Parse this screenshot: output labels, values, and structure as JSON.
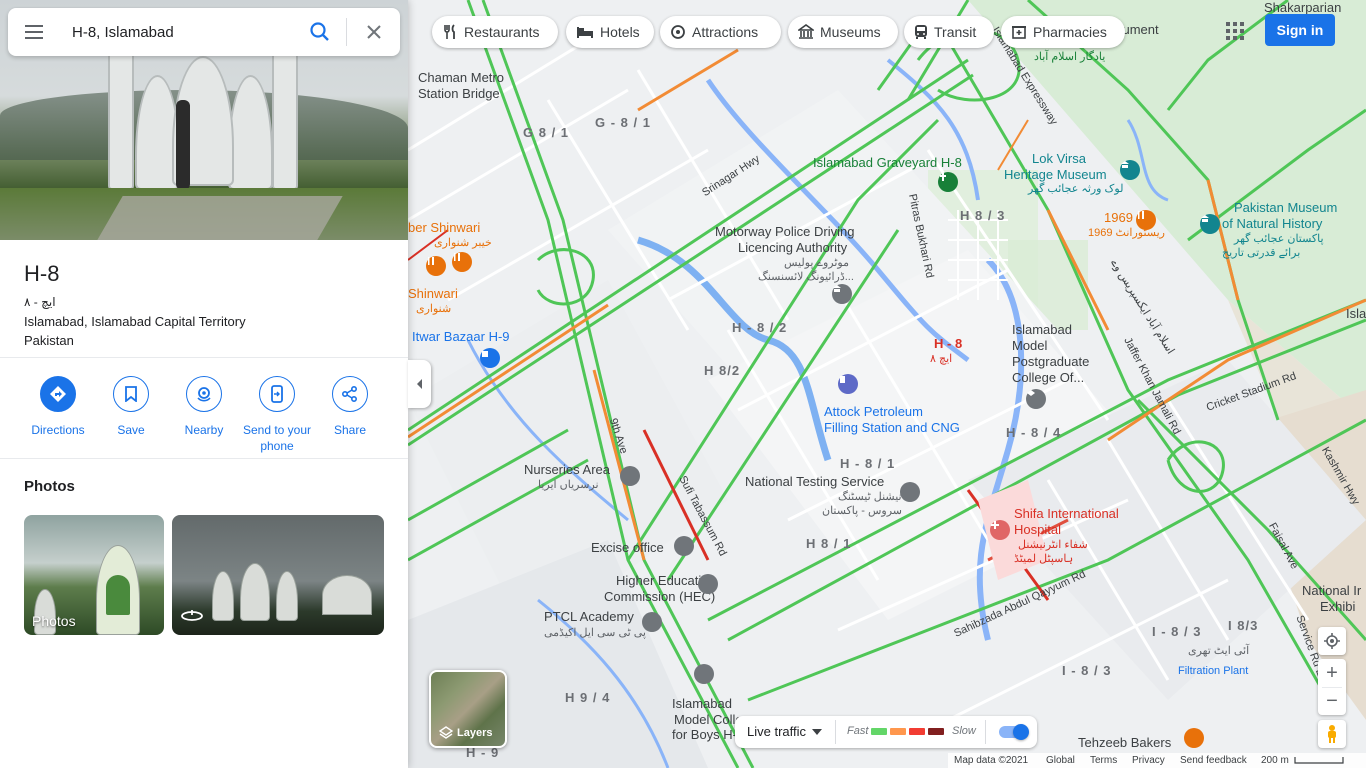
{
  "search": {
    "value": "H-8, Islamabad",
    "menu_icon": "hamburger-menu-icon",
    "search_icon": "magnifier-icon",
    "clear_icon": "close-icon"
  },
  "place": {
    "title": "H-8",
    "subtitle": "ایچ - ۸",
    "address_line1": "Islamabad, Islamabad Capital Territory",
    "address_line2": "Pakistan"
  },
  "actions": [
    {
      "label": "Directions",
      "icon": "directions-icon"
    },
    {
      "label": "Save",
      "icon": "bookmark-icon"
    },
    {
      "label": "Nearby",
      "icon": "nearby-icon"
    },
    {
      "label": "Send to your phone",
      "icon": "phone-send-icon"
    },
    {
      "label": "Share",
      "icon": "share-icon"
    }
  ],
  "photos": {
    "title": "Photos",
    "items": [
      {
        "label": "Photos"
      },
      {
        "label": "",
        "icon": "360-icon"
      }
    ]
  },
  "chips": [
    {
      "label": "Restaurants",
      "icon": "fork-knife-icon"
    },
    {
      "label": "Hotels",
      "icon": "bed-icon"
    },
    {
      "label": "Attractions",
      "icon": "attraction-icon"
    },
    {
      "label": "Museums",
      "icon": "museum-icon"
    },
    {
      "label": "Transit",
      "icon": "bus-icon"
    },
    {
      "label": "Pharmacies",
      "icon": "pharmacy-icon"
    }
  ],
  "top_right": {
    "apps_icon": "apps-grid-icon",
    "sign_in": "Sign in"
  },
  "layers": {
    "label": "Layers",
    "icon": "layers-icon"
  },
  "traffic": {
    "select_label": "Live traffic",
    "fast": "Fast",
    "slow": "Slow",
    "colors": [
      "#63d668",
      "#ff974d",
      "#f23c32",
      "#811f1f"
    ],
    "toggle_on": true
  },
  "map_controls": {
    "locate_icon": "my-location-icon",
    "zoom_in": "+",
    "zoom_out": "−",
    "pegman_icon": "pegman-icon"
  },
  "footer": {
    "map_data": "Map data ©2021",
    "global": "Global",
    "terms": "Terms",
    "privacy": "Privacy",
    "feedback": "Send feedback",
    "scale": "200 m"
  },
  "map_labels": {
    "chaman_metro": "Chaman Metro",
    "station_bridge": "Station Bridge",
    "g81a": "G 8 / 1",
    "g81b": "G - 8 / 1",
    "onument": "onument",
    "pakistan_monument_urdu": "یادگار اسلام آباد",
    "srinagar_hwy": "Srinagar Hwy",
    "graveyard": "Islamabad Graveyard H-8",
    "lok_virsa_1": "Lok Virsa",
    "lok_virsa_2": "Heritage Museum",
    "lok_virsa_urdu": "لوک ورثہ عجائب گھر",
    "museum_nh_1": "Pakistan Museum",
    "museum_nh_2": "of Natural History",
    "museum_nh_urdu1": "پاکستان عجائب گھر",
    "museum_nh_urdu2": "برائے قدرتی تاریخ",
    "r1969": "1969",
    "r1969_urdu": "1969 ریسٹورانٹ",
    "shinwari_a": "ber Shinwari",
    "shinwari_a_urdu": "خیبر شنواری",
    "shinwari_b": "Shinwari",
    "shinwari_b_urdu": "شنواری",
    "itwar_bazaar": "Itwar Bazaar H-9",
    "motorway_1": "Motorway Police Driving",
    "motorway_2": "Licencing Authority",
    "motorway_urdu1": "موٹروے پولیس",
    "motorway_urdu2": "ڈرائیونگ لائسنسنگ...",
    "h82a": "H - 8 / 2",
    "h82b": "H 8/2",
    "h83": "H 8 / 3",
    "h8": "H - 8",
    "h8_urdu": "ایچ ۸",
    "imcpg_1": "Islamabad",
    "imcpg_2": "Model",
    "imcpg_3": "Postgraduate",
    "imcpg_4": "College Of...",
    "attock_1": "Attock Petroleum",
    "attock_2": "Filling Station and CNG",
    "h84": "H - 8 / 4",
    "h81a": "H - 8 / 1",
    "h81b": "H 8 / 1",
    "nursery_1": "Nurseries Area",
    "nursery_urdu": "نرسریاں ایریا",
    "nts_1": "National Testing Service",
    "nts_urdu1": "نیشنل ٹیسٹنگ",
    "nts_urdu2": "سروس - پاکستان",
    "shifa_1": "Shifa International",
    "shifa_2": "Hospital",
    "shifa_urdu1": "شفاء انٹرنیشنل",
    "shifa_urdu2": "ہاسپٹل لمیٹڈ",
    "excise": "Excise office",
    "hec_1": "Higher Education",
    "hec_2": "Commission (HEC)",
    "ptcl_1": "PTCL Academy",
    "ptcl_urdu": "پی ٹی سی ایل اکیڈمی",
    "imcb_1": "Islamabad",
    "imcb_2": "Model Colle",
    "imcb_3": "for Boys H-9",
    "h94": "H 9 / 4",
    "h9": "H - 9",
    "i83a": "I - 8 / 3",
    "i83b": "I 8/3",
    "i83c": "I - 8 / 3",
    "i83_urdu": "آئی ایٹ تھری",
    "filtration": "Filtration Plant",
    "tehzeeb": "Tehzeeb Bakers",
    "national_1": "National Ir",
    "national_2": "Exhibi",
    "isla": "Isla",
    "kan": "Ka",
    "shakarparian": "Shakarparian",
    "pitras": "Pitras Bukhari Rd",
    "ninth_ave": "9th Ave",
    "sufi_rd": "Sufi Tabassum Rd",
    "sahibzada": "Sahibzada Abdul Qayyum Rd",
    "faisal": "Faisal Ave",
    "jaffer": "Jaffer Khan Jamali Rd",
    "kashmir": "Kashmir Hwy",
    "cricket": "Cricket Stadium Rd",
    "service_rd": "Service Rd E",
    "expressway": "Islamabad Expressway",
    "expressway_urdu": "اسلام آباد ایکسپریس وے"
  }
}
